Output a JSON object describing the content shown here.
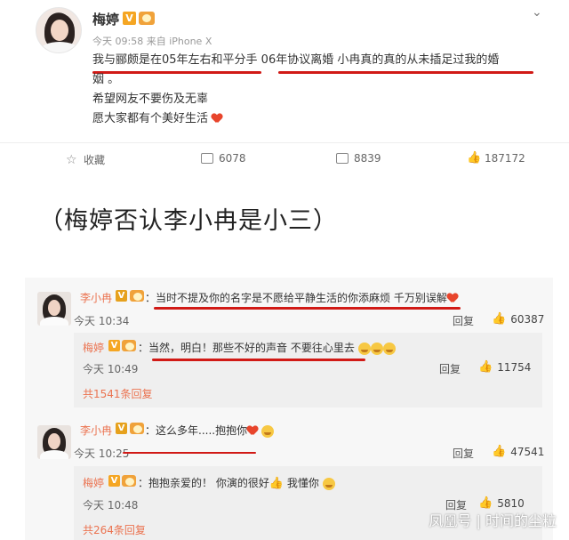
{
  "post": {
    "author": "梅婷",
    "meta": "今天 09:58 来自 iPhone X",
    "lines": [
      "我与郦颇是在05年左右和平分手  06年协议离婚 小冉真的真的从未插足过我的婚",
      "姻 。",
      "希望网友不要伤及无辜",
      "愿大家都有个美好生活"
    ],
    "actions": {
      "favorite": "收藏",
      "forward_count": "6078",
      "comment_count": "8839",
      "like_count": "187172"
    }
  },
  "caption": "（梅婷否认李小冉是小三）",
  "comments": [
    {
      "author": "李小冉",
      "text": "：当时不提及你的名字是不愿给平静生活的你添麻烦 千万别误解",
      "time": "今天 10:34",
      "reply": "回复",
      "likes": "60387",
      "nested": {
        "author": "梅婷",
        "text": "：当然，明白！那些不好的声音 不要往心里去",
        "time": "今天 10:49",
        "reply": "回复",
        "likes": "11754"
      },
      "more": "共1541条回复"
    },
    {
      "author": "李小冉",
      "text": "：这么多年.....抱抱你",
      "time": "今天 10:25",
      "reply": "回复",
      "likes": "47541",
      "nested": {
        "author": "梅婷",
        "text": "：抱抱亲爱的！ 你演的很好",
        "text_tail": " 我懂你",
        "time": "今天 10:48",
        "reply": "回复",
        "likes": "5810"
      },
      "more": "共264条回复"
    }
  ],
  "watermark": "凤凰号 | 时间的尘粒",
  "colors": {
    "accent_orange": "#eb7350",
    "underline_red": "#d11a16",
    "verified_badge": "#f5a623"
  },
  "icons": [
    "chevron-down-icon",
    "star-icon",
    "forward-icon",
    "comment-icon",
    "thumb-up-icon",
    "heart-icon",
    "emoji-icon"
  ]
}
